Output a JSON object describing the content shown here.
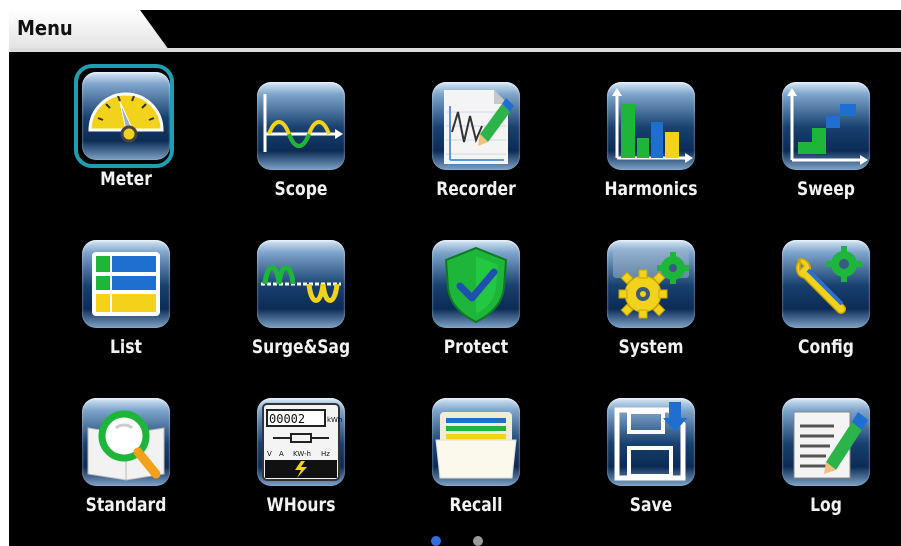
{
  "header": {
    "title": "Menu"
  },
  "colors": {
    "selection_ring": "#1e9fb0",
    "pager_active": "#2f6fe0",
    "pager_inactive": "#9a9a9a"
  },
  "menu": {
    "items": [
      {
        "label": "Meter",
        "icon": "meter-gauge-icon",
        "selected": true
      },
      {
        "label": "Scope",
        "icon": "scope-waveform-icon"
      },
      {
        "label": "Recorder",
        "icon": "recorder-chart-icon"
      },
      {
        "label": "Harmonics",
        "icon": "harmonics-bars-icon"
      },
      {
        "label": "Sweep",
        "icon": "sweep-steps-icon"
      },
      {
        "label": "List",
        "icon": "list-table-icon"
      },
      {
        "label": "Surge&Sag",
        "icon": "surge-sag-wave-icon"
      },
      {
        "label": "Protect",
        "icon": "protect-shield-icon"
      },
      {
        "label": "System",
        "icon": "system-gears-icon"
      },
      {
        "label": "Config",
        "icon": "config-wrench-gear-icon"
      },
      {
        "label": "Standard",
        "icon": "standard-magnifier-book-icon"
      },
      {
        "label": "WHours",
        "icon": "watt-hour-meter-icon",
        "display": "00002",
        "units": [
          "kWh",
          "V",
          "A",
          "KW-h",
          "Hz"
        ]
      },
      {
        "label": "Recall",
        "icon": "recall-folder-icon"
      },
      {
        "label": "Save",
        "icon": "save-floppy-icon"
      },
      {
        "label": "Log",
        "icon": "log-document-pen-icon"
      }
    ]
  },
  "pager": {
    "pages": 2,
    "current": 1
  }
}
